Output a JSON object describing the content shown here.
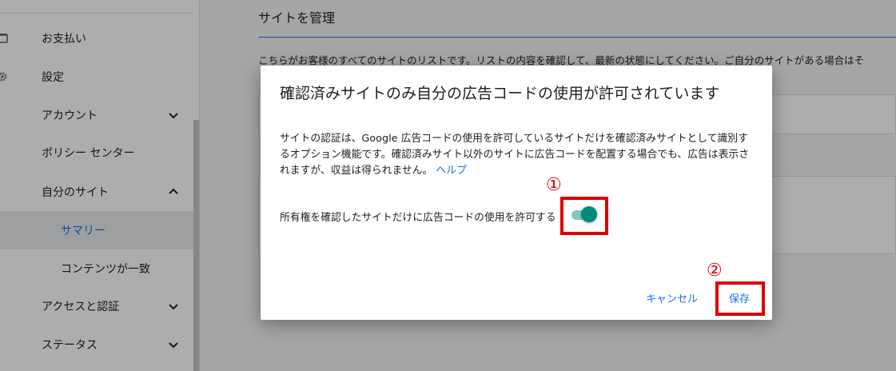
{
  "sidebar": {
    "items": [
      {
        "label": "お支払い",
        "icon": "payment-icon"
      },
      {
        "label": "設定",
        "icon": "gear-icon"
      },
      {
        "label": "アカウント",
        "chevron": "chevron-down-icon"
      },
      {
        "label": "ポリシー センター"
      },
      {
        "label": "自分のサイト",
        "chevron": "chevron-up-icon"
      },
      {
        "label": "サマリー",
        "active": true
      },
      {
        "label": "コンテンツが一致"
      },
      {
        "label": "アクセスと認証",
        "chevron": "chevron-down-icon"
      },
      {
        "label": "ステータス",
        "chevron": "chevron-down-icon"
      }
    ]
  },
  "main": {
    "title": "サイトを管理",
    "description": "こちらがお客様のすべてのサイトのリストです。リストの内容を確認して、最新の状態にしてください。ご自分のサイトがある場合はそ"
  },
  "dialog": {
    "title": "確認済みサイトのみ自分の広告コードの使用が許可されています",
    "body": "サイトの認証は、Google 広告コードの使用を許可しているサイトだけを確認済みサイトとして識別するオプション機能です。確認済みサイト以外のサイトに広告コードを配置する場合でも、広告は表示されますが、収益は得られません。",
    "help_link": "ヘルプ",
    "toggle_label": "所有権を確認したサイトだけに広告コードの使用を許可する",
    "toggle_on": true,
    "cancel_label": "キャンセル",
    "save_label": "保存"
  },
  "annotations": {
    "marker1": "①",
    "marker2": "②",
    "color": "#e00000"
  },
  "colors": {
    "accent": "#1a73e8",
    "toggle_on": "#00897b"
  }
}
